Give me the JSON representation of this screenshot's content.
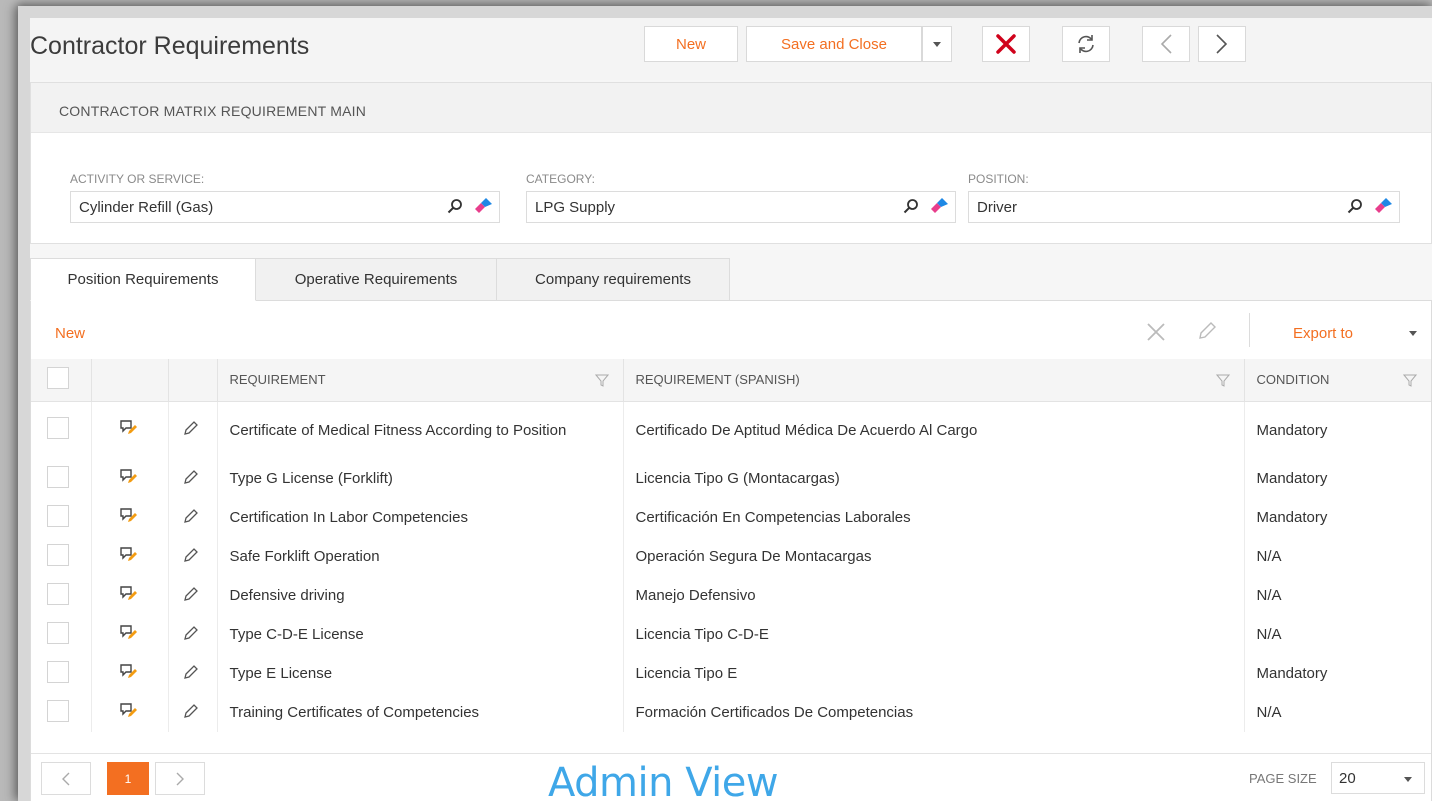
{
  "header": {
    "title": "Contractor Requirements",
    "new_label": "New",
    "save_close_label": "Save and Close"
  },
  "panel": {
    "heading": "CONTRACTOR MATRIX REQUIREMENT MAIN",
    "fields": [
      {
        "label": "ACTIVITY OR SERVICE:",
        "value": "Cylinder Refill (Gas)"
      },
      {
        "label": "CATEGORY:",
        "value": "LPG Supply"
      },
      {
        "label": "POSITION:",
        "value": "Driver"
      }
    ]
  },
  "tabs": [
    {
      "label": "Position Requirements",
      "active": true
    },
    {
      "label": "Operative Requirements",
      "active": false
    },
    {
      "label": "Company requirements",
      "active": false
    }
  ],
  "toolbar": {
    "new_label": "New",
    "export_label": "Export to"
  },
  "grid": {
    "columns": [
      "REQUIREMENT",
      "REQUIREMENT (SPANISH)",
      "CONDITION"
    ],
    "rows": [
      {
        "requirement": "Certificate of Medical Fitness According to Position",
        "spanish": "Certificado De Aptitud Médica De Acuerdo Al Cargo",
        "condition": "Mandatory"
      },
      {
        "requirement": "Type G License (Forklift)",
        "spanish": "Licencia Tipo G (Montacargas)",
        "condition": "Mandatory"
      },
      {
        "requirement": "Certification In Labor Competencies",
        "spanish": "Certificación En Competencias Laborales",
        "condition": "Mandatory"
      },
      {
        "requirement": "Safe Forklift Operation",
        "spanish": "Operación Segura De Montacargas",
        "condition": "N/A"
      },
      {
        "requirement": "Defensive driving",
        "spanish": "Manejo Defensivo",
        "condition": "N/A"
      },
      {
        "requirement": "Type C-D-E License",
        "spanish": "Licencia Tipo C-D-E",
        "condition": "N/A"
      },
      {
        "requirement": "Type E License",
        "spanish": "Licencia Tipo E",
        "condition": "Mandatory"
      },
      {
        "requirement": "Training Certificates of Competencies",
        "spanish": "Formación Certificados De Competencias",
        "condition": "N/A"
      }
    ]
  },
  "pager": {
    "current_page": "1",
    "watermark": "Admin View",
    "page_size_label": "PAGE SIZE",
    "page_size": "20"
  },
  "colors": {
    "accent": "#f36f21",
    "delete": "#d0021b",
    "watermark": "#3fa7e8"
  }
}
